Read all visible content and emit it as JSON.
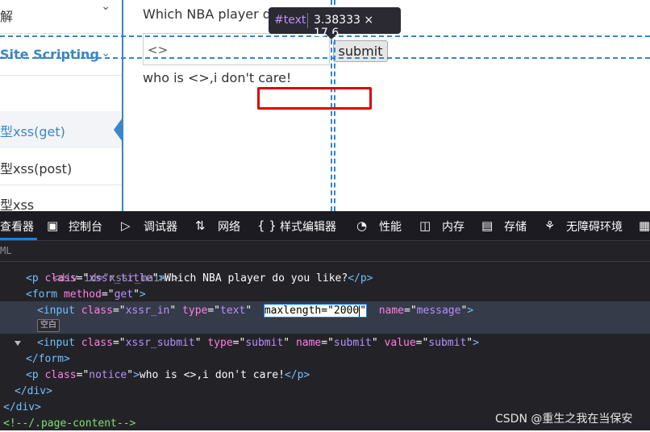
{
  "sidebar": {
    "items": [
      {
        "label": "解",
        "expanded": false
      },
      {
        "label": "Site Scripting",
        "expanded": true
      },
      {
        "label": "型xss(get)",
        "active": true
      },
      {
        "label": "型xss(post)"
      },
      {
        "label": "型xss"
      }
    ]
  },
  "main": {
    "title": "Which NBA player do",
    "input_value": "<>",
    "submit_label": "submit",
    "notice": "who is <>,i don't care!"
  },
  "tooltip": {
    "tag": "#text",
    "size": "3.38333 × 17.6"
  },
  "devtools": {
    "tabs": [
      {
        "label": "查看器",
        "icon": "inspector-icon"
      },
      {
        "label": "控制台",
        "icon": "console-icon"
      },
      {
        "label": "调试器",
        "icon": "debugger-icon"
      },
      {
        "label": "网络",
        "icon": "network-icon"
      },
      {
        "label": "样式编辑器",
        "icon": "style-editor-icon"
      },
      {
        "label": "性能",
        "icon": "performance-icon"
      },
      {
        "label": "内存",
        "icon": "memory-icon"
      },
      {
        "label": "存储",
        "icon": "storage-icon"
      },
      {
        "label": "无障碍环境",
        "icon": "accessibility-icon"
      }
    ],
    "breadcrumb": "ML",
    "code": {
      "line0": "<div id=\"xssr_main\">",
      "p_title": {
        "cls": "xssr_title",
        "text": "Which NBA player do you like?"
      },
      "form": {
        "method": "get"
      },
      "input1": {
        "cls": "xssr_in",
        "type": "text",
        "maxlength": "maxlength=\"2000",
        "name": "message"
      },
      "whitespace_badge": "空白",
      "input2": {
        "cls": "xssr_submit",
        "type": "submit",
        "name": "submit",
        "value": "submit"
      },
      "p_notice": {
        "cls": "notice",
        "text": "who is <>,i don't care!"
      },
      "comment": "<!--/.page-content-->"
    }
  },
  "watermark": "CSDN @重生之我在当保安",
  "colors": {
    "link_blue": "#3a86c8",
    "highlight_blue": "#2f86d4",
    "devtools_bg": "#232327",
    "selection_red": "#e00000"
  }
}
